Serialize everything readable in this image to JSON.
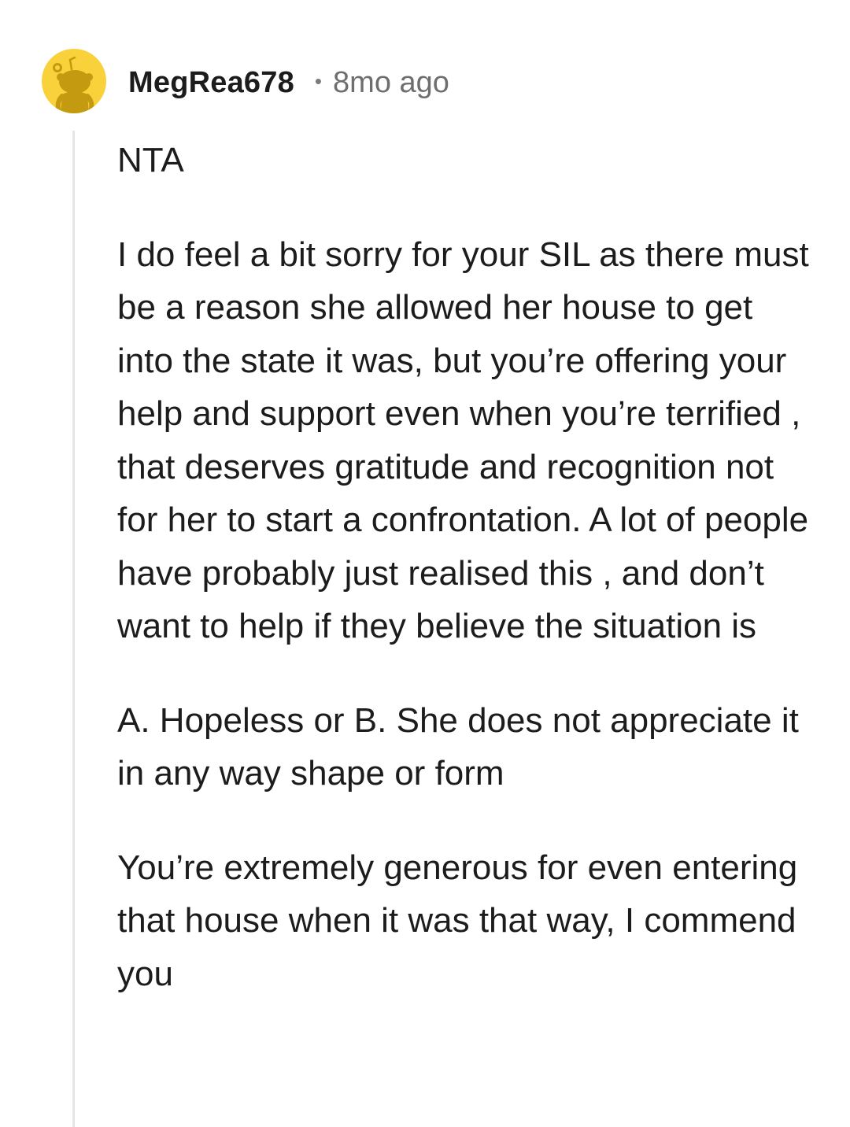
{
  "comment": {
    "avatar_icon": "reddit-snoo-avatar-icon",
    "avatar_color": "#f8d13b",
    "username": "MegRea678",
    "separator": "•",
    "timestamp": "8mo ago",
    "paragraphs": [
      "NTA",
      "I do feel a bit sorry for your SIL as there must be a reason she allowed her house to get into the state it was, but you’re offering your help and support even when you’re terrified , that deserves gratitude and recognition not for her to start a confrontation. A lot of people have probably just realised this , and don’t want to help if they believe the situation is",
      "A. Hopeless or B. She does not appreciate it in any way shape or form",
      "You’re extremely generous for even entering that house when it was that way, I commend you"
    ]
  }
}
